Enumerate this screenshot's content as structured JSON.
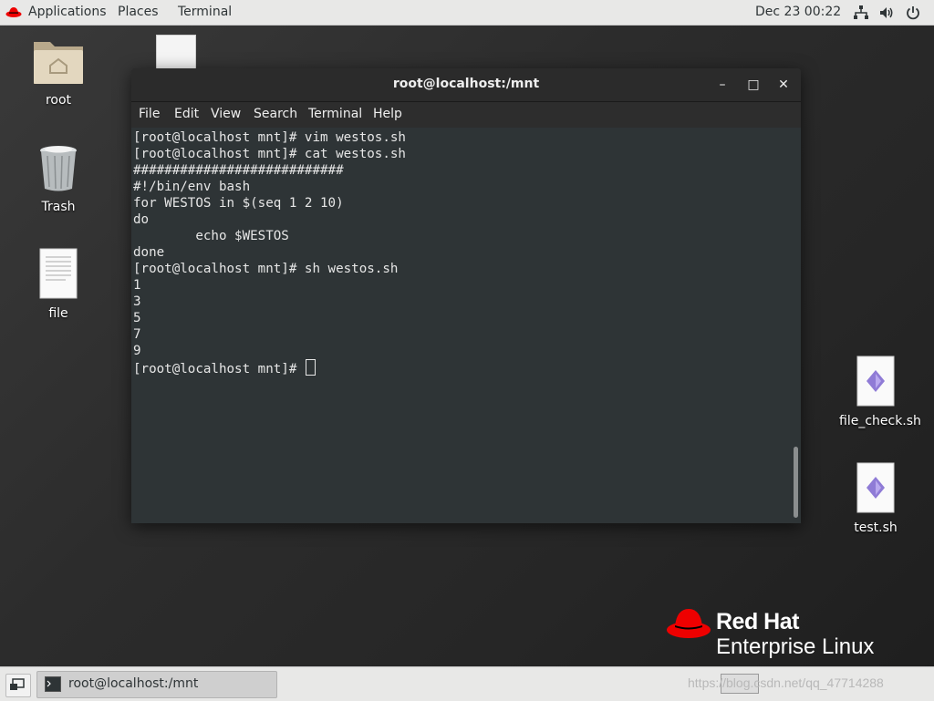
{
  "topbar": {
    "applications": "Applications",
    "places": "Places",
    "terminal": "Terminal",
    "clock": "Dec 23  00:22",
    "icons": [
      "network-icon",
      "volume-icon",
      "power-icon"
    ]
  },
  "desktop": {
    "icons": [
      {
        "label": "root",
        "icon": "home-folder-icon"
      },
      {
        "label": "Trash",
        "icon": "trash-icon"
      },
      {
        "label": "file",
        "icon": "document-icon"
      },
      {
        "label": "file_check.sh",
        "icon": "script-icon"
      },
      {
        "label": "test.sh",
        "icon": "script-icon"
      }
    ]
  },
  "window": {
    "title": "root@localhost:/mnt",
    "buttons": {
      "minimize": "–",
      "maximize": "□",
      "close": "✕"
    },
    "menu": [
      "File",
      "Edit",
      "View",
      "Search",
      "Terminal",
      "Help"
    ],
    "terminal_text": "[root@localhost mnt]# vim westos.sh\n[root@localhost mnt]# cat westos.sh\n###########################\n#!/bin/env bash\nfor WESTOS in $(seq 1 2 10)\ndo\n        echo $WESTOS\ndone\n[root@localhost mnt]# sh westos.sh\n1\n3\n5\n7\n9\n[root@localhost mnt]# "
  },
  "branding": {
    "line1": "Red Hat",
    "line2": "Enterprise Linux",
    "color": "#ee0000"
  },
  "taskbar": {
    "task_label": "root@localhost:/mnt",
    "watermark": "https://blog.csdn.net/qq_47714288"
  }
}
